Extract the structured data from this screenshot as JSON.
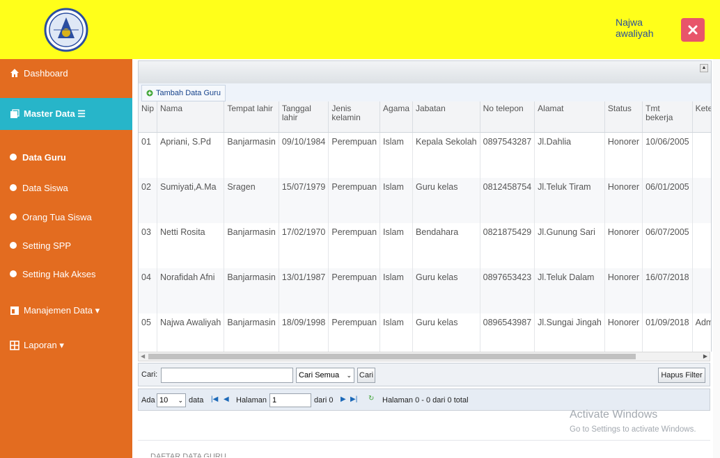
{
  "header": {
    "user_name": "Najwa awaliyah"
  },
  "sidebar": {
    "items": [
      {
        "label": "Dashboard",
        "icon": "home-icon"
      },
      {
        "label": "Master Data ☰",
        "icon": "folder-icon"
      },
      {
        "label": "Data Guru"
      },
      {
        "label": "Data Siswa"
      },
      {
        "label": "Orang Tua Siswa"
      },
      {
        "label": "Setting SPP"
      },
      {
        "label": "Setting Hak Akses"
      },
      {
        "label": "Manajemen Data ▾",
        "icon": "table-icon"
      },
      {
        "label": "Laporan ▾",
        "icon": "grid-icon"
      }
    ]
  },
  "toolbar": {
    "add_label": "Tambah Data Guru"
  },
  "table": {
    "headers": [
      "Nip",
      "Nama",
      "Tempat lahir",
      "Tanggal lahir",
      "Jenis kelamin",
      "Agama",
      "Jabatan",
      "No telepon",
      "Alamat",
      "Status",
      "Tmt bekerja",
      "Keteran"
    ],
    "rows": [
      [
        "01",
        "Apriani, S.Pd",
        "Banjarmasin",
        "09/10/1984",
        "Perempuan",
        "Islam",
        "Kepala Sekolah",
        "0897543287",
        "Jl.Dahlia",
        "Honorer",
        "10/06/2005",
        ""
      ],
      [
        "02",
        "Sumiyati,A.Ma",
        "Sragen",
        "15/07/1979",
        "Perempuan",
        "Islam",
        "Guru kelas",
        "0812458754",
        "Jl.Teluk Tiram",
        "Honorer",
        "06/01/2005",
        ""
      ],
      [
        "03",
        "Netti Rosita",
        "Banjarmasin",
        "17/02/1970",
        "Perempuan",
        "Islam",
        "Bendahara",
        "0821875429",
        "Jl.Gunung Sari",
        "Honorer",
        "06/07/2005",
        ""
      ],
      [
        "04",
        "Norafidah Afni",
        "Banjarmasin",
        "13/01/1987",
        "Perempuan",
        "Islam",
        "Guru kelas",
        "0897653423",
        "Jl.Teluk Dalam",
        "Honorer",
        "16/07/2018",
        ""
      ],
      [
        "05",
        "Najwa Awaliyah",
        "Banjarmasin",
        "18/09/1998",
        "Perempuan",
        "Islam",
        "Guru kelas",
        "0896543987",
        "Jl.Sungai Jingah",
        "Honorer",
        "01/09/2018",
        "Admin"
      ]
    ]
  },
  "search": {
    "label": "Cari:",
    "value": "",
    "select_value": "Cari Semua",
    "button": "Cari",
    "clear_button": "Hapus Filter"
  },
  "pager": {
    "show_label": "Ada",
    "per_page": "10",
    "per_page_suffix": "data",
    "page_label": "Halaman",
    "page_value": "1",
    "of_label": "dari 0",
    "summary": "Halaman 0 - 0 dari 0 total"
  },
  "watermark": {
    "line1": "Activate Windows",
    "line2": "Go to Settings to activate Windows."
  },
  "footer": {
    "partial_text": "DAFTAR DATA GURU"
  },
  "colors": {
    "header_bg": "#ffff1a",
    "sidebar_bg": "#e36c20",
    "sidebar_active": "#27b5c9",
    "close_button": "#e8556a",
    "username": "#2a4f9a"
  }
}
